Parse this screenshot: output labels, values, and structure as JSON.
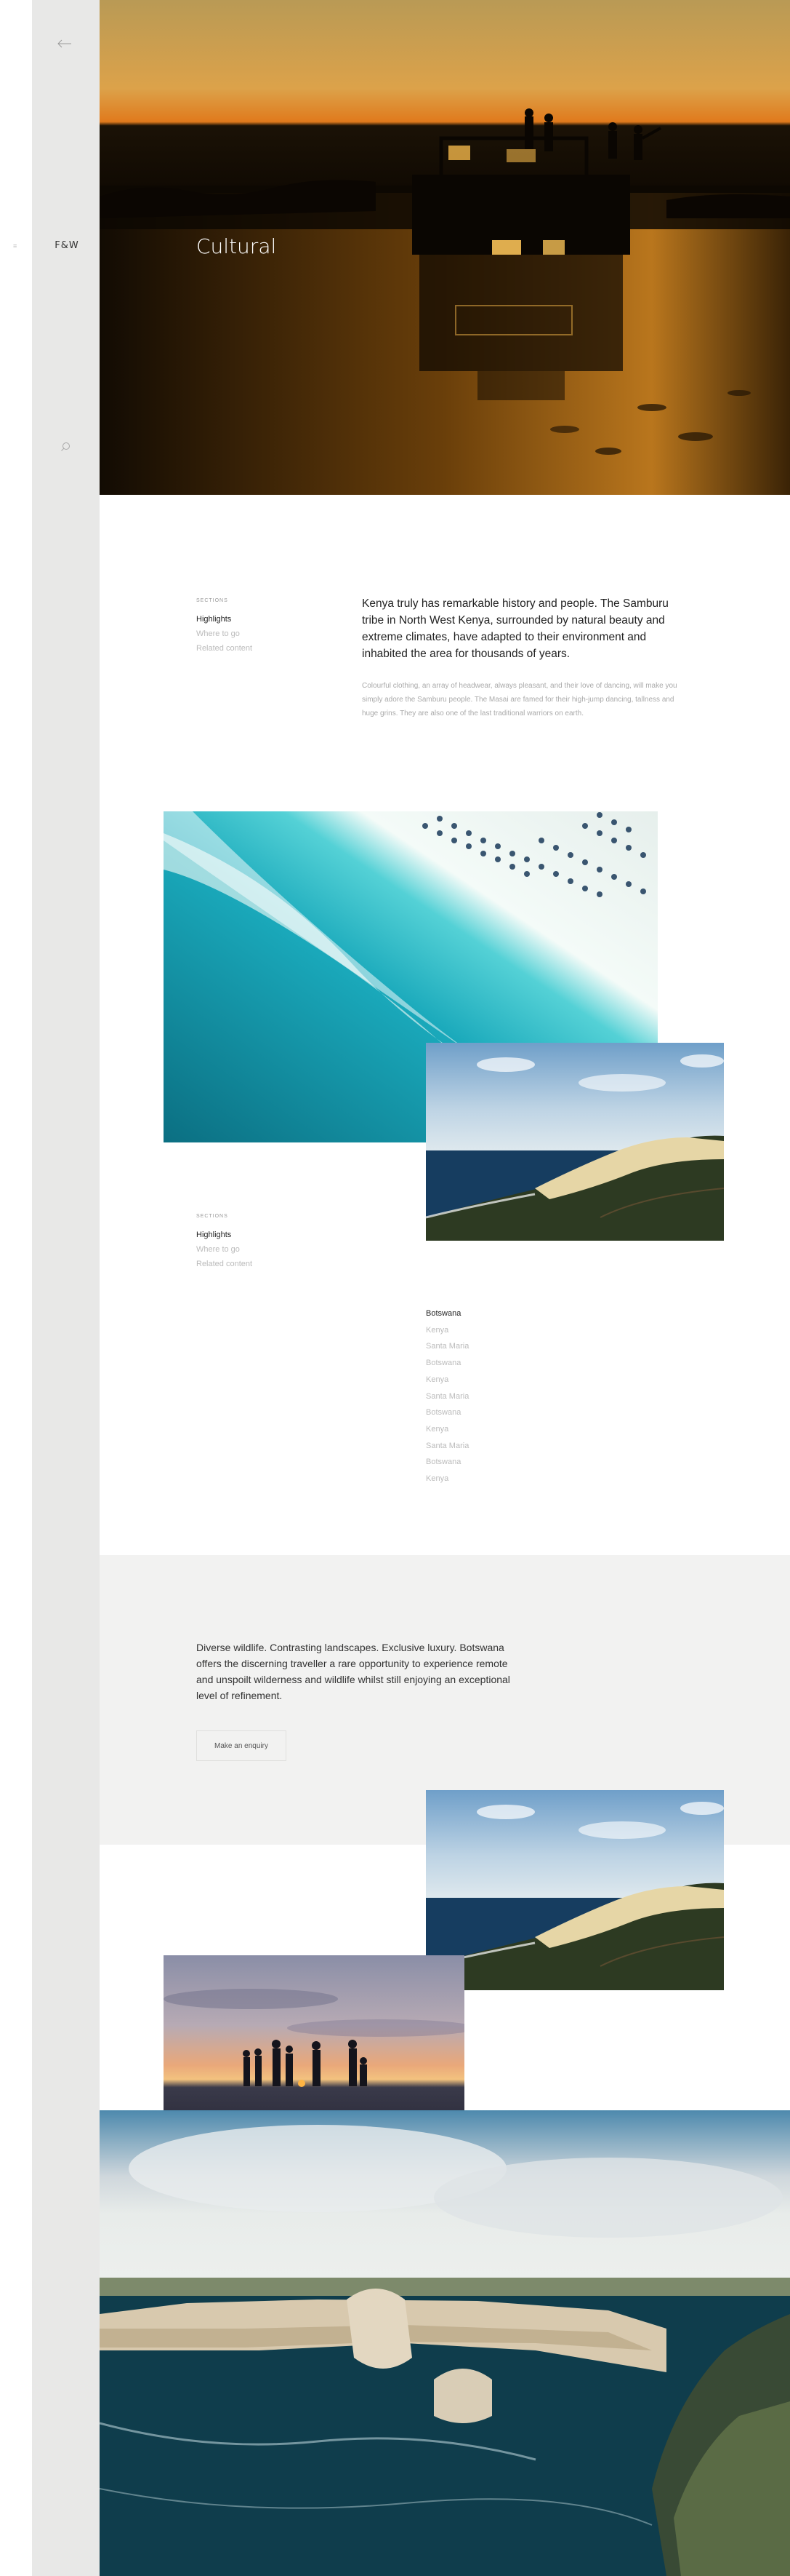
{
  "brand": {
    "logo": "F&W"
  },
  "hero": {
    "title": "Cultural"
  },
  "sections_nav_1": {
    "label": "SECTIONS",
    "items": [
      "Highlights",
      "Where to go",
      "Related content"
    ]
  },
  "intro": {
    "lead": "Kenya truly has remarkable history and people. The Samburu tribe in North West Kenya, surrounded by natural beauty and extreme climates, have adapted to their environment and inhabited the area for thousands of years.",
    "body": "Colourful clothing, an array of headwear, always pleasant, and their love of dancing, will make you simply adore the Samburu people.  The Masai are famed for their high-jump dancing, tallness and huge grins. They are also one of the last traditional warriors on earth."
  },
  "sections_nav_2": {
    "label": "SECTIONS",
    "items": [
      "Highlights",
      "Where to go",
      "Related content"
    ]
  },
  "destinations": [
    "Botswana",
    "Kenya",
    "Santa Maria",
    "Botswana",
    "Kenya",
    "Santa Maria",
    "Botswana",
    "Kenya",
    "Santa Maria",
    "Botswana",
    "Kenya"
  ],
  "promo": {
    "quote": "Diverse wildlife. Contrasting landscapes. Exclusive luxury. Botswana offers the discerning traveller a rare opportunity to experience remote and unspoilt wilderness and wildlife whilst still enjoying an exceptional level of refinement.",
    "button": "Make an enquiry"
  },
  "icons": {
    "back": "arrow-left-icon",
    "menu": "menu-dot-icon",
    "search": "search-icon"
  }
}
